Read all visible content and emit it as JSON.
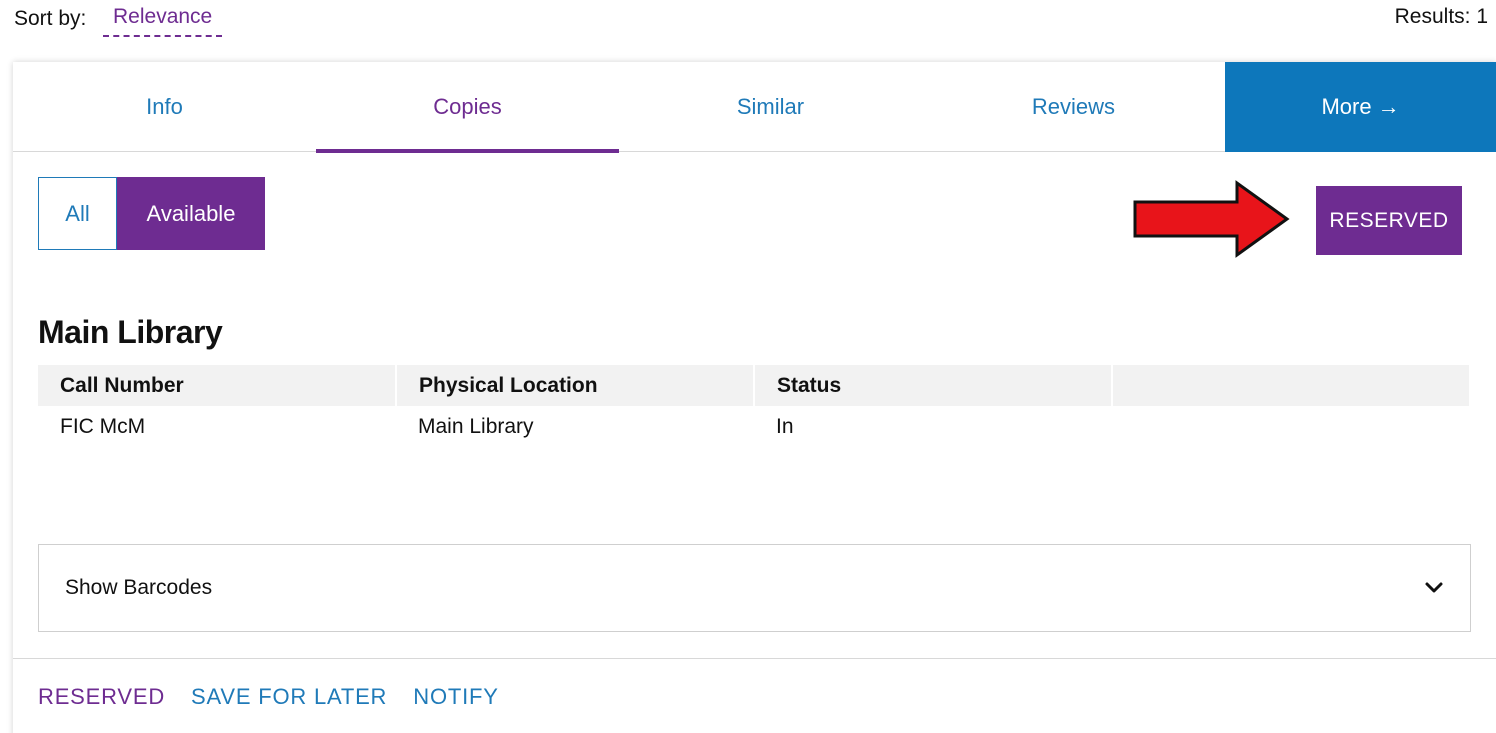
{
  "sort": {
    "label": "Sort by:",
    "value": "Relevance"
  },
  "results": {
    "text": "Results: 1"
  },
  "tabs": [
    {
      "label": "Info"
    },
    {
      "label": "Copies"
    },
    {
      "label": "Similar"
    },
    {
      "label": "Reviews"
    },
    {
      "label": "More",
      "arrow": "→"
    }
  ],
  "filter": {
    "all": "All",
    "available": "Available"
  },
  "reserved_button": {
    "label": "RESERVED"
  },
  "section": {
    "title": "Main Library",
    "columns": [
      "Call Number",
      "Physical Location",
      "Status",
      ""
    ],
    "rows": [
      {
        "call_number": "FIC McM",
        "location": "Main Library",
        "status": "In"
      }
    ]
  },
  "barcodes": {
    "label": "Show Barcodes",
    "icon": "chevron-down-icon"
  },
  "actions": {
    "reserved": "RESERVED",
    "save": "SAVE FOR LATER",
    "notify": "NOTIFY"
  },
  "colors": {
    "accent_purple": "#6e2c91",
    "link_blue": "#1f7ab8",
    "more_tab_blue": "#0d77bb",
    "annotation_red": "#e8141a"
  }
}
